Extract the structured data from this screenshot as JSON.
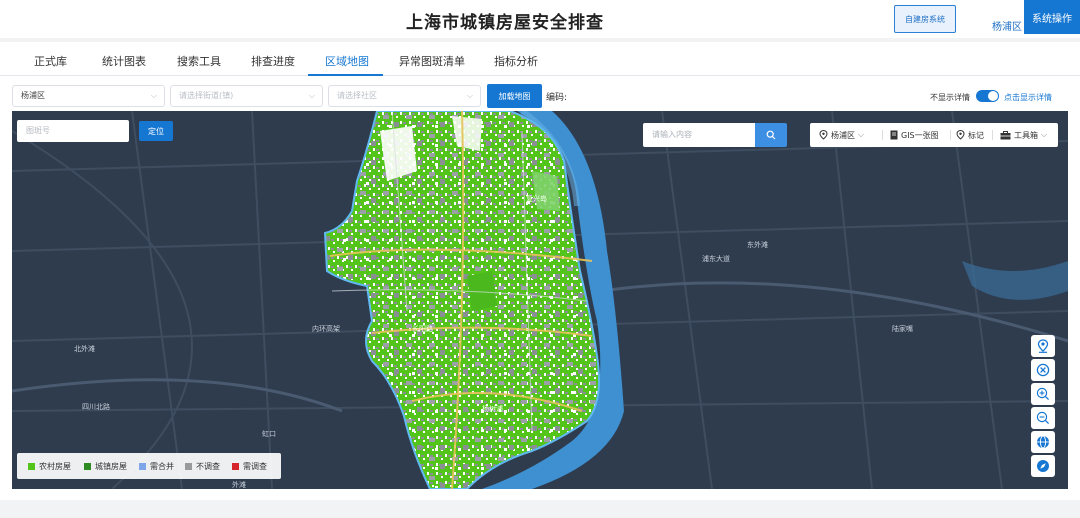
{
  "header": {
    "title": "上海市城镇房屋安全排查",
    "self_built_label": "自建房系统",
    "district": "杨浦区",
    "system_ops_label": "系统操作"
  },
  "tabs": [
    {
      "label": "正式库",
      "active": false
    },
    {
      "label": "统计图表",
      "active": false
    },
    {
      "label": "搜索工具",
      "active": false
    },
    {
      "label": "排查进度",
      "active": false
    },
    {
      "label": "区域地图",
      "active": true
    },
    {
      "label": "异常图斑清单",
      "active": false
    },
    {
      "label": "指标分析",
      "active": false
    }
  ],
  "filters": {
    "district_value": "杨浦区",
    "street_placeholder": "请选择街道(镇)",
    "community_placeholder": "请选择社区",
    "load_map_label": "加载地图",
    "code_label": "编码:"
  },
  "detail_toggle": {
    "off_label": "不显示详情",
    "on_label": "点击显示详情",
    "enabled": true
  },
  "map": {
    "parcel_placeholder": "图斑号",
    "locate_label": "定位",
    "search_placeholder": "请输入内容",
    "toolbar": {
      "district": "杨浦区",
      "gis_label": "GIS一张图",
      "mark_label": "标记",
      "toolbox_label": "工具箱"
    },
    "legend": [
      {
        "label": "农村房屋",
        "color": "#52c41a"
      },
      {
        "label": "城镇房屋",
        "color": "#2e8b22"
      },
      {
        "label": "需合并",
        "color": "#7fa6e8"
      },
      {
        "label": "不调查",
        "color": "#9a9a9a"
      },
      {
        "label": "需调查",
        "color": "#d6262b"
      }
    ],
    "place_labels": {
      "p1": "长阳路",
      "p2": "杨树浦",
      "p3": "复兴岛",
      "p4": "内环高架",
      "p5": "北外滩",
      "p6": "陆家嘴",
      "p7": "东外滩",
      "p8": "虹口",
      "p9": "四川北路",
      "p10": "外滩",
      "p11": "浦东大道"
    },
    "controls": [
      "locate-pin-icon",
      "clear-circle-icon",
      "zoom-in-icon",
      "zoom-out-icon",
      "globe-icon",
      "compass-icon"
    ]
  }
}
